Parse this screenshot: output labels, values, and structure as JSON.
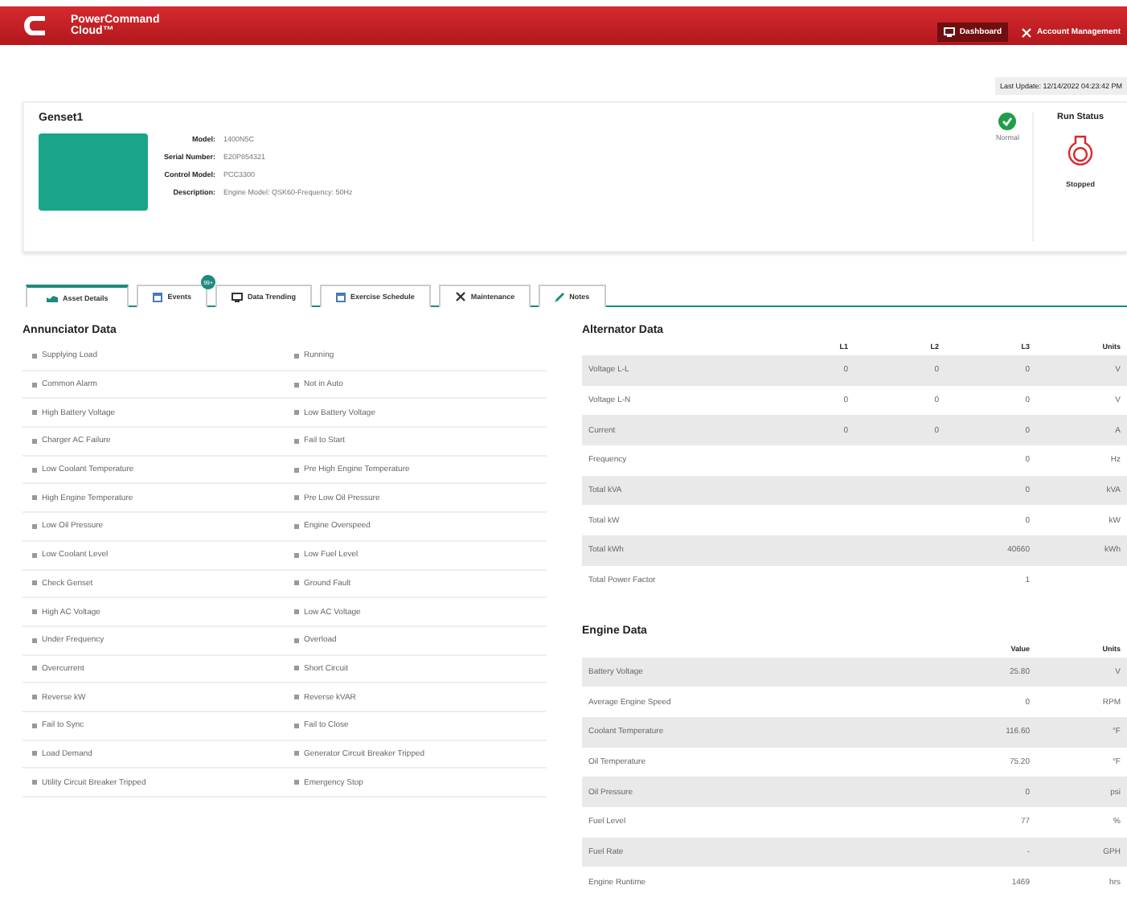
{
  "header": {
    "brand_line1": "PowerCommand",
    "brand_line2": "Cloud™",
    "nav": [
      {
        "label": "Dashboard",
        "selected": true,
        "kind": "monitor"
      },
      {
        "label": "Account Management",
        "selected": false,
        "kind": "tools"
      }
    ]
  },
  "last_update": "Last Update: 12/14/2022 04:23:42 PM",
  "asset": {
    "name": "Genset1",
    "fields": [
      {
        "label": "Model:",
        "value": "1400N5C"
      },
      {
        "label": "Serial Number:",
        "value": "E20P854321"
      },
      {
        "label": "Control Model:",
        "value": "PCC3300"
      },
      {
        "label": "Description:",
        "value": "Engine Model: QSK60-Frequency: 50Hz"
      }
    ],
    "health": "Normal",
    "run_status_title": "Run Status",
    "run_status": "Stopped"
  },
  "tabs": [
    {
      "label": "Asset Details",
      "selected": true,
      "kind": "chart"
    },
    {
      "label": "Events",
      "selected": false,
      "kind": "calendar",
      "badge": "99+"
    },
    {
      "label": "Data Trending",
      "selected": false,
      "kind": "monitor"
    },
    {
      "label": "Exercise Schedule",
      "selected": false,
      "kind": "calendar"
    },
    {
      "label": "Maintenance",
      "selected": false,
      "kind": "tools"
    },
    {
      "label": "Notes",
      "selected": false,
      "kind": "pencil"
    }
  ],
  "annunciator": {
    "title": "Annunciator Data",
    "items": [
      "Supplying Load",
      "Running",
      "Common Alarm",
      "Not in Auto",
      "High Battery Voltage",
      "Low Battery Voltage",
      "Charger AC Failure",
      "Fail to Start",
      "Low Coolant Temperature",
      "Pre High Engine Temperature",
      "High Engine Temperature",
      "Pre Low Oil Pressure",
      "Low Oil Pressure",
      "Engine Overspeed",
      "Low Coolant Level",
      "Low Fuel Level",
      "Check Genset",
      "Ground Fault",
      "High AC Voltage",
      "Low AC Voltage",
      "Under Frequency",
      "Overload",
      "Overcurrent",
      "Short Circuit",
      "Reverse kW",
      "Reverse kVAR",
      "Fail to Sync",
      "Fail to Close",
      "Load Demand",
      "Generator Circuit Breaker Tripped",
      "Utility Circuit Breaker Tripped",
      "Emergency Stop"
    ]
  },
  "alternator": {
    "title": "Alternator Data",
    "columns": [
      "",
      "L1",
      "L2",
      "L3",
      "Units"
    ],
    "rows": [
      [
        "Voltage L-L",
        "0",
        "0",
        "0",
        "V"
      ],
      [
        "Voltage L-N",
        "0",
        "0",
        "0",
        "V"
      ],
      [
        "Current",
        "0",
        "0",
        "0",
        "A"
      ],
      [
        "Frequency",
        "",
        "",
        "0",
        "Hz"
      ],
      [
        "Total kVA",
        "",
        "",
        "0",
        "kVA"
      ],
      [
        "Total kW",
        "",
        "",
        "0",
        "kW"
      ],
      [
        "Total kWh",
        "",
        "",
        "40660",
        "kWh"
      ],
      [
        "Total Power Factor",
        "",
        "",
        "1",
        ""
      ]
    ]
  },
  "engine": {
    "title": "Engine Data",
    "columns": [
      "",
      "Value",
      "Units"
    ],
    "rows": [
      [
        "Battery Voltage",
        "25.80",
        "V"
      ],
      [
        "Average Engine Speed",
        "0",
        "RPM"
      ],
      [
        "Coolant Temperature",
        "116.60",
        "°F"
      ],
      [
        "Oil Temperature",
        "75.20",
        "°F"
      ],
      [
        "Oil Pressure",
        "0",
        "psi"
      ],
      [
        "Fuel Level",
        "77",
        "%"
      ],
      [
        "Fuel Rate",
        "-",
        "GPH"
      ],
      [
        "Engine Runtime",
        "1469",
        "hrs"
      ]
    ]
  }
}
